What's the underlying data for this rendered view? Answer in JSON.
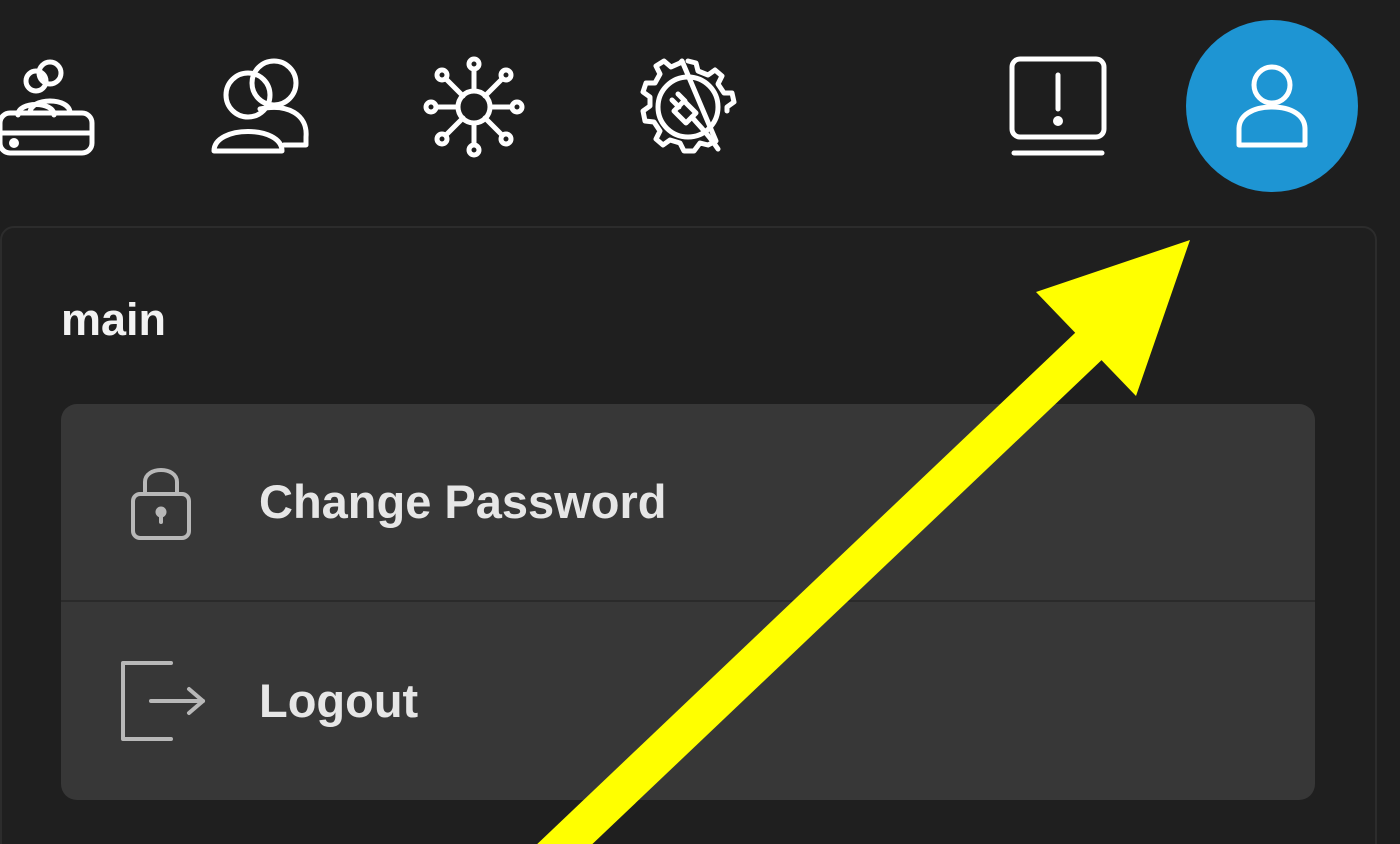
{
  "toolbar": {
    "icons": [
      "storage-users-icon",
      "users-icon",
      "network-icon",
      "plugin-settings-icon",
      "alerts-icon"
    ]
  },
  "user_menu": {
    "avatar_icon": "user-icon",
    "username": "main",
    "items": [
      {
        "label": "Change Password",
        "icon": "lock-icon"
      },
      {
        "label": "Logout",
        "icon": "logout-icon"
      }
    ]
  },
  "colors": {
    "background": "#1e1e1e",
    "avatar": "#1e95d3",
    "menu_surface": "#373737",
    "annotation": "#ffff00"
  }
}
